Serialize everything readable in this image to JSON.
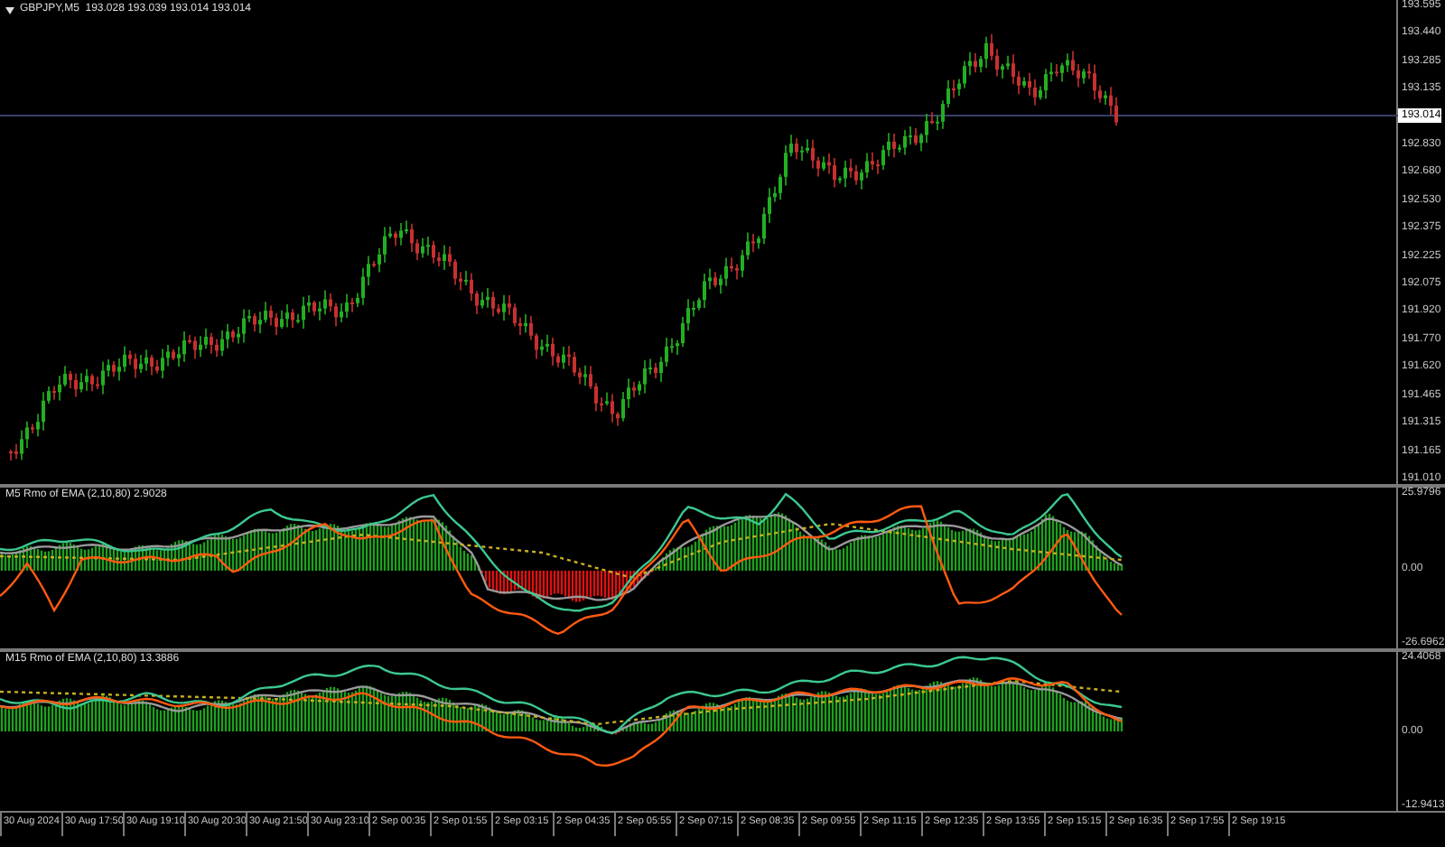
{
  "main_chart": {
    "header": "GBPJPY,M5  193.028 193.039 193.014 193.014",
    "current_price": "193.014",
    "price_axis": [
      "193.595",
      "193.440",
      "193.285",
      "193.135",
      "192.830",
      "192.680",
      "192.530",
      "192.375",
      "192.225",
      "192.075",
      "191.920",
      "191.770",
      "191.620",
      "191.465",
      "191.315",
      "191.165",
      "191.010"
    ]
  },
  "indicators": [
    {
      "title": "M5 Rmo of EMA (2,10,80) 2.9028",
      "axis": [
        "25.9796",
        "0.00",
        "-26.6962"
      ]
    },
    {
      "title": "M15 Rmo of EMA (2,10,80) 13.3886",
      "axis": [
        "24.4068",
        "0.00",
        "-12.9413"
      ]
    }
  ],
  "time_axis": [
    "30 Aug 2024",
    "30 Aug 17:50",
    "30 Aug 19:10",
    "30 Aug 20:30",
    "30 Aug 21:50",
    "30 Aug 23:10",
    "2 Sep 00:35",
    "2 Sep 01:55",
    "2 Sep 03:15",
    "2 Sep 04:35",
    "2 Sep 05:55",
    "2 Sep 07:15",
    "2 Sep 08:35",
    "2 Sep 09:55",
    "2 Sep 11:15",
    "2 Sep 12:35",
    "2 Sep 13:55",
    "2 Sep 15:15",
    "2 Sep 16:35",
    "2 Sep 17:55",
    "2 Sep 19:15"
  ]
}
